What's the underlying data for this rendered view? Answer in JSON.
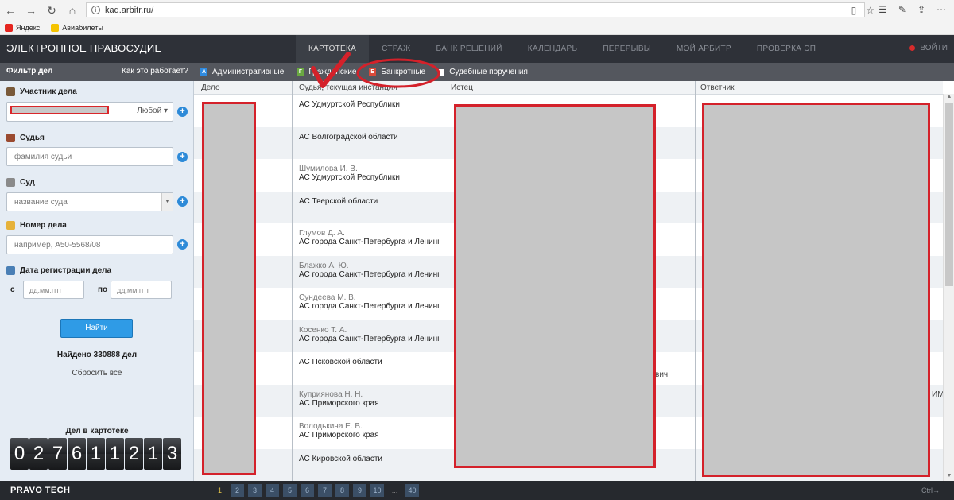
{
  "browser": {
    "url": "kad.arbitr.ru/",
    "bookmarks": [
      "Яндекс",
      "Авиабилеты"
    ]
  },
  "header": {
    "site_title": "ЭЛЕКТРОННОЕ ПРАВОСУДИЕ",
    "tabs": [
      "КАРТОТЕКА",
      "СТРАЖ",
      "БАНК РЕШЕНИЙ",
      "КАЛЕНДАРЬ",
      "ПЕРЕРЫВЫ",
      "МОЙ АРБИТР",
      "ПРОВЕРКА ЭП"
    ],
    "active_tab": "КАРТОТЕКА",
    "login": "ВОЙТИ"
  },
  "filter_bar": {
    "title": "Фильтр дел",
    "how_it_works": "Как это работает?",
    "case_types": [
      {
        "label": "Административные",
        "icon_letter": "А",
        "color": "#2f8be0"
      },
      {
        "label": "Гражданские",
        "icon_letter": "Г",
        "color": "#6aa842"
      },
      {
        "label": "Банкротные",
        "icon_letter": "Б",
        "color": "#d94a3a"
      },
      {
        "label": "Судебные поручения",
        "icon_letter": "",
        "color": "#ffffff"
      }
    ]
  },
  "sidebar": {
    "participant_label": "Участник дела",
    "participant_mode": "Любой",
    "judge_label": "Судья",
    "judge_placeholder": "фамилия судьи",
    "court_label": "Суд",
    "court_placeholder": "название суда",
    "case_number_label": "Номер дела",
    "case_number_placeholder": "например, А50-5568/08",
    "reg_date_label": "Дата регистрации дела",
    "date_from_label": "с",
    "date_to_label": "по",
    "date_placeholder": "дд.мм.гггг",
    "find_button": "Найти",
    "found_text": "Найдено 330888 дел",
    "reset_all": "Сбросить все",
    "counter_label": "Дел в картотеке",
    "counter_digits": [
      "0",
      "2",
      "7",
      "6",
      "1",
      "1",
      "2",
      "1",
      "3"
    ]
  },
  "table": {
    "columns": [
      "Дело",
      "Судья, текущая инстанция",
      "Истец",
      "Ответчик"
    ],
    "rows": [
      {
        "judge": "",
        "court": "АС Удмуртской Республики"
      },
      {
        "judge": "",
        "court": "АС Волгоградской области"
      },
      {
        "judge": "Шумилова И. В.",
        "court": "АС Удмуртской Республики"
      },
      {
        "judge": "",
        "court": "АС Тверской области"
      },
      {
        "judge": "Глумов Д. А.",
        "court": "АС города Санкт-Петербурга и Ленинг"
      },
      {
        "judge": "Блажко А. Ю.",
        "court": "АС города Санкт-Петербурга и Ленинг"
      },
      {
        "judge": "Сундеева М. В.",
        "court": "АС города Санкт-Петербурга и Ленинг"
      },
      {
        "judge": "Косенко Т. А.",
        "court": "АС города Санкт-Петербурга и Ленинг"
      },
      {
        "judge": "",
        "court": "АС Псковской области"
      },
      {
        "judge": "Куприянова Н. Н.",
        "court": "АС Приморского края"
      },
      {
        "judge": "Володькина Е. В.",
        "court": "АС Приморского края"
      },
      {
        "judge": "",
        "court": "АС Кировской области"
      }
    ],
    "plaintiff_fragment": "вич",
    "defendant_fragment": "ИМ"
  },
  "footer": {
    "brand": "PRAVO TECH",
    "pages": [
      "1",
      "2",
      "3",
      "4",
      "5",
      "6",
      "7",
      "8",
      "9",
      "10",
      "...",
      "40"
    ],
    "current_page": "1",
    "shortcut_hint": "Ctrl→"
  }
}
